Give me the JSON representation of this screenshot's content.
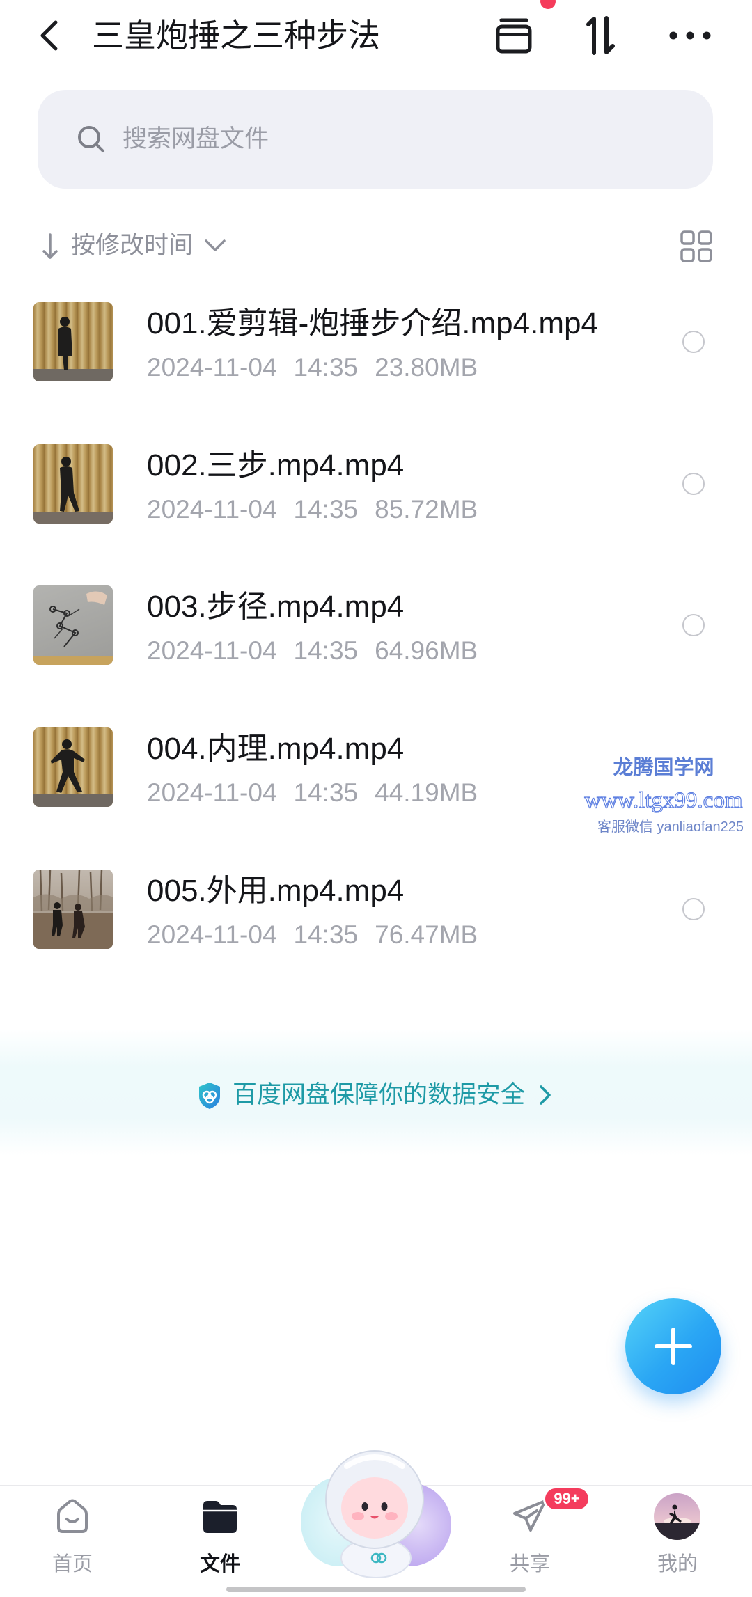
{
  "header": {
    "title": "三皇炮捶之三种步法",
    "back_icon": "chevron-left-icon",
    "archive_icon": "archive-box-icon",
    "sort_icon": "swap-vertical-icon",
    "more_icon": "more-dots-icon",
    "notification_dot": true
  },
  "search": {
    "placeholder": "搜索网盘文件",
    "icon": "search-icon"
  },
  "sort": {
    "label": "按修改时间",
    "direction_icon": "arrow-down-icon",
    "dropdown_icon": "chevron-down-icon",
    "view_toggle_icon": "grid-view-icon"
  },
  "files": [
    {
      "name": "001.爱剪辑-炮捶步介绍.mp4.mp4",
      "date": "2024-11-04",
      "time": "14:35",
      "size": "23.80MB",
      "selected": false
    },
    {
      "name": "002.三步.mp4.mp4",
      "date": "2024-11-04",
      "time": "14:35",
      "size": "85.72MB",
      "selected": false
    },
    {
      "name": "003.步径.mp4.mp4",
      "date": "2024-11-04",
      "time": "14:35",
      "size": "64.96MB",
      "selected": false
    },
    {
      "name": "004.内理.mp4.mp4",
      "date": "2024-11-04",
      "time": "14:35",
      "size": "44.19MB",
      "selected": false
    },
    {
      "name": "005.外用.mp4.mp4",
      "date": "2024-11-04",
      "time": "14:35",
      "size": "76.47MB",
      "selected": false
    }
  ],
  "watermark": {
    "name": "龙腾国学网",
    "url": "www.ltgx99.com",
    "contact": "客服微信 yanliaofan225"
  },
  "banner": {
    "text": "百度网盘保障你的数据安全",
    "icon": "shield-icon",
    "chevron": "chevron-right-icon"
  },
  "fab": {
    "icon": "plus-icon"
  },
  "nav": {
    "items": [
      {
        "label": "首页",
        "icon": "home-icon",
        "active": false
      },
      {
        "label": "文件",
        "icon": "folder-icon",
        "active": true
      },
      {
        "label": "共享",
        "icon": "paper-plane-icon",
        "badge": "99+",
        "active": false
      },
      {
        "label": "我的",
        "icon": "avatar",
        "active": false
      }
    ],
    "center_icon": "mascot-icon"
  },
  "colors": {
    "primary_text": "#141519",
    "secondary_text": "#a3a5ad",
    "search_bg": "#eff0f6",
    "accent_teal": "#1e9aa6",
    "fab_blue": "#2aa6f4",
    "badge_red": "#f43c5d",
    "notification_dot": "#f53b5b",
    "watermark_blue": "#5b7ed5"
  }
}
